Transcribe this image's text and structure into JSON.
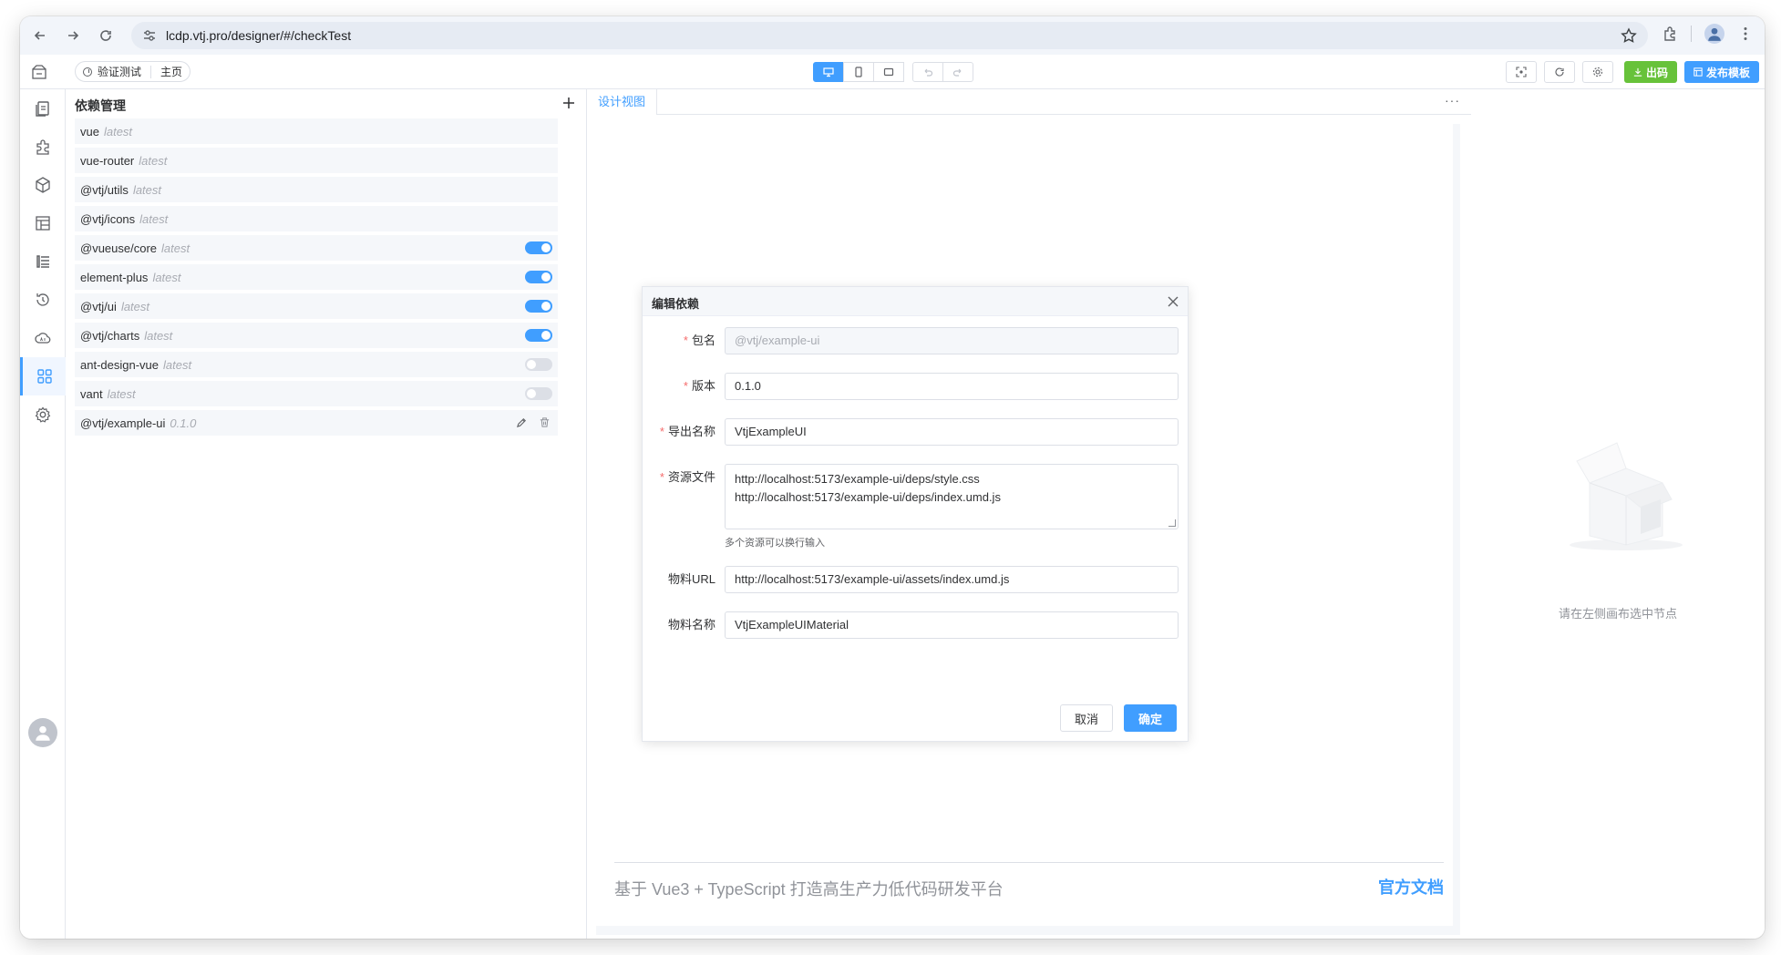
{
  "browser": {
    "url": "lcdp.vtj.pro/designer/#/checkTest"
  },
  "toolbar": {
    "tab_active": "验证测试",
    "tab_home": "主页",
    "btn_code": "出码",
    "btn_publish": "发布模板"
  },
  "deps_panel": {
    "title": "依赖管理",
    "items": [
      {
        "name": "vue",
        "version": "latest",
        "toggle": null
      },
      {
        "name": "vue-router",
        "version": "latest",
        "toggle": null
      },
      {
        "name": "@vtj/utils",
        "version": "latest",
        "toggle": null
      },
      {
        "name": "@vtj/icons",
        "version": "latest",
        "toggle": null
      },
      {
        "name": "@vueuse/core",
        "version": "latest",
        "toggle": "on"
      },
      {
        "name": "element-plus",
        "version": "latest",
        "toggle": "on"
      },
      {
        "name": "@vtj/ui",
        "version": "latest",
        "toggle": "on"
      },
      {
        "name": "@vtj/charts",
        "version": "latest",
        "toggle": "on"
      },
      {
        "name": "ant-design-vue",
        "version": "latest",
        "toggle": "off"
      },
      {
        "name": "vant",
        "version": "latest",
        "toggle": "off"
      },
      {
        "name": "@vtj/example-ui",
        "version": "0.1.0",
        "toggle": "edit"
      }
    ]
  },
  "center": {
    "tab": "设计视图",
    "more": "···",
    "footer_text": "基于 Vue3 + TypeScript 打造高生产力低代码研发平台",
    "footer_link": "官方文档"
  },
  "right_panel": {
    "empty_text": "请在左侧画布选中节点"
  },
  "dialog": {
    "title": "编辑依赖",
    "fields": {
      "package_label": "包名",
      "package_value": "@vtj/example-ui",
      "version_label": "版本",
      "version_value": "0.1.0",
      "export_label": "导出名称",
      "export_value": "VtjExampleUI",
      "assets_label": "资源文件",
      "assets_line1": "http://localhost:5173/example-ui/deps/style.css",
      "assets_line2": "http://localhost:5173/example-ui/deps/index.umd.js",
      "assets_hint": "多个资源可以换行输入",
      "material_url_label": "物料URL",
      "material_url_value": "http://localhost:5173/example-ui/assets/index.umd.js",
      "material_name_label": "物料名称",
      "material_name_value": "VtjExampleUIMaterial"
    },
    "cancel": "取消",
    "confirm": "确定"
  },
  "colors": {
    "primary": "#409eff",
    "success": "#67c23a",
    "danger": "#f56c6c"
  }
}
